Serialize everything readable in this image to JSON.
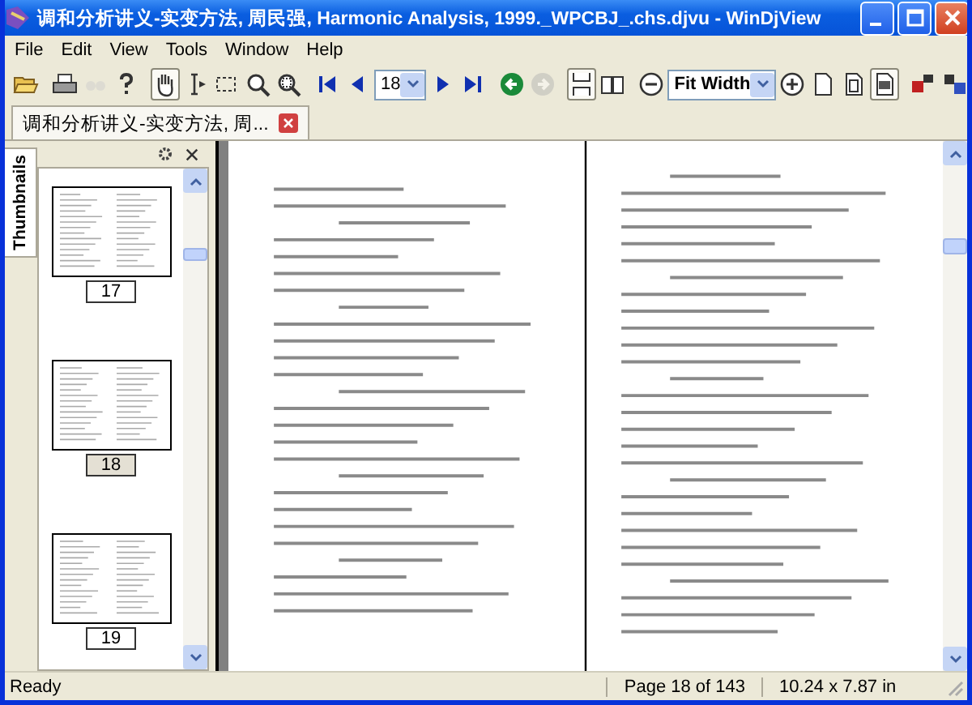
{
  "window": {
    "title": "调和分析讲义-实变方法, 周民强, Harmonic Analysis, 1999._WPCBJ_.chs.djvu - WinDjView"
  },
  "menu": [
    "File",
    "Edit",
    "View",
    "Tools",
    "Window",
    "Help"
  ],
  "toolbar": [
    {
      "kind": "open",
      "pressed": false,
      "disabled": false
    },
    {
      "kind": "sep"
    },
    {
      "kind": "print",
      "pressed": false,
      "disabled": false
    },
    {
      "kind": "find",
      "pressed": false,
      "disabled": true
    },
    {
      "kind": "help",
      "pressed": false,
      "disabled": false
    },
    {
      "kind": "sep"
    },
    {
      "kind": "hand",
      "pressed": true,
      "disabled": false
    },
    {
      "kind": "select-text",
      "pressed": false,
      "disabled": false
    },
    {
      "kind": "select-rect",
      "pressed": false,
      "disabled": false
    },
    {
      "kind": "zoom",
      "pressed": false,
      "disabled": false
    },
    {
      "kind": "zoom-rect",
      "pressed": false,
      "disabled": false
    },
    {
      "kind": "sep"
    },
    {
      "kind": "first",
      "pressed": false,
      "disabled": false
    },
    {
      "kind": "prev",
      "pressed": false,
      "disabled": false
    },
    {
      "kind": "page-field",
      "value": "18"
    },
    {
      "kind": "next",
      "pressed": false,
      "disabled": false
    },
    {
      "kind": "last",
      "pressed": false,
      "disabled": false
    },
    {
      "kind": "sep"
    },
    {
      "kind": "back",
      "pressed": false,
      "disabled": false
    },
    {
      "kind": "forward",
      "pressed": false,
      "disabled": true
    },
    {
      "kind": "sep"
    },
    {
      "kind": "continuous",
      "pressed": true,
      "disabled": false
    },
    {
      "kind": "facing",
      "pressed": false,
      "disabled": false
    },
    {
      "kind": "sep"
    },
    {
      "kind": "zoom-out",
      "pressed": false,
      "disabled": false
    },
    {
      "kind": "zoom-field",
      "value": "Fit Width"
    },
    {
      "kind": "zoom-in",
      "pressed": false,
      "disabled": false
    },
    {
      "kind": "actual",
      "pressed": false,
      "disabled": false
    },
    {
      "kind": "fit-page",
      "pressed": false,
      "disabled": false
    },
    {
      "kind": "fit-width",
      "pressed": true,
      "disabled": false
    },
    {
      "kind": "sep"
    },
    {
      "kind": "rotate-left",
      "pressed": false,
      "disabled": false
    },
    {
      "kind": "rotate-right",
      "pressed": false,
      "disabled": false
    }
  ],
  "tabs": [
    {
      "label": "调和分析讲义-实变方法, 周...",
      "selected": true
    }
  ],
  "sidebar": {
    "tab": "Thumbnails",
    "thumbnails": [
      {
        "label": "17",
        "selected": false
      },
      {
        "label": "18",
        "selected": true
      },
      {
        "label": "19",
        "selected": false
      }
    ]
  },
  "status_bar": {
    "message": "Ready",
    "page": "Page 18 of 143",
    "size": "10.24 x 7.87 in"
  }
}
